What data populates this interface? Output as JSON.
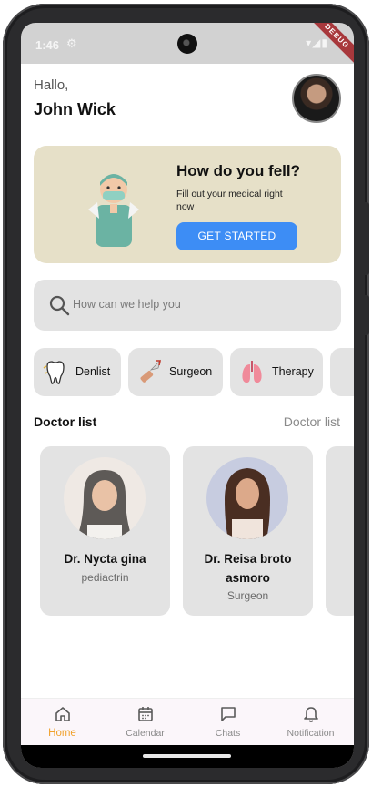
{
  "status_bar": {
    "time": "1:46",
    "debug_label": "DEBUG"
  },
  "header": {
    "greeting": "Hallo,",
    "user_name": "John Wick"
  },
  "hero": {
    "title": "How do you fell?",
    "subtitle": "Fill out your medical right now",
    "button_label": "GET STARTED",
    "bg_color": "#e6e0c8",
    "button_color": "#3d8df5"
  },
  "search": {
    "placeholder": "How can we help you"
  },
  "categories": [
    {
      "label": "Denlist",
      "icon": "tooth-icon"
    },
    {
      "label": "Surgeon",
      "icon": "scalpel-icon"
    },
    {
      "label": "Therapy",
      "icon": "lungs-icon"
    }
  ],
  "doctor_section": {
    "title": "Doctor list",
    "link_label": "Doctor list"
  },
  "doctors": [
    {
      "name": "Dr. Nycta gina",
      "specialty": "pediactrin"
    },
    {
      "name": "Dr. Reisa broto asmoro",
      "specialty": "Surgeon"
    }
  ],
  "bottom_nav": {
    "active_color": "#f0a12b",
    "items": [
      {
        "label": "Home",
        "icon": "home-icon"
      },
      {
        "label": "Calendar",
        "icon": "calendar-icon"
      },
      {
        "label": "Chats",
        "icon": "chat-icon"
      },
      {
        "label": "Notification",
        "icon": "bell-icon"
      }
    ]
  }
}
